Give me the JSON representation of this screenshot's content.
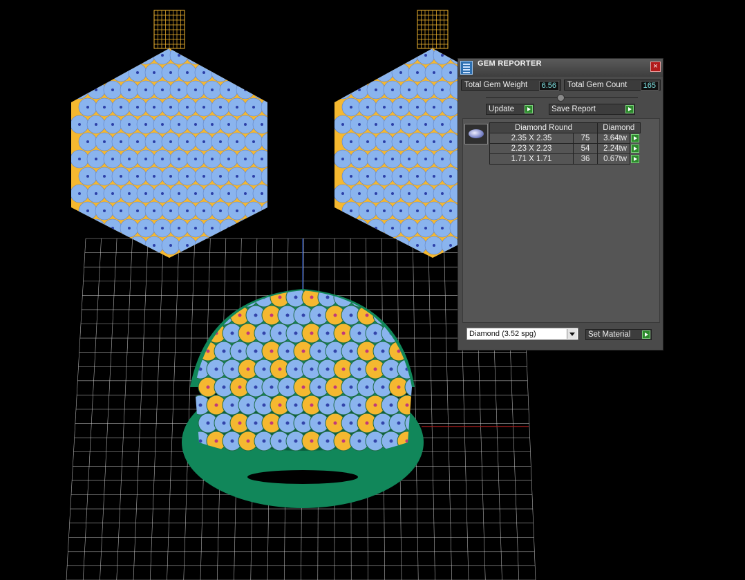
{
  "viewport": {
    "colors": {
      "metal": "#f5b830",
      "gem": "#8ab4ee",
      "shank": "#11875a",
      "grid": "#cfcfcf"
    }
  },
  "gem_reporter": {
    "title": "GEM REPORTER",
    "close_label": "×",
    "total_weight_label": "Total Gem Weight",
    "total_weight_value": "6.56",
    "total_count_label": "Total Gem Count",
    "total_count_value": "165",
    "update_label": "Update",
    "save_report_label": "Save Report",
    "table": {
      "header_shape": "Diamond Round",
      "header_material": "Diamond",
      "rows": [
        {
          "size": "2.35 X 2.35",
          "count": "75",
          "weight": "3.64tw"
        },
        {
          "size": "2.23 X 2.23",
          "count": "54",
          "weight": "2.24tw"
        },
        {
          "size": "1.71 X 1.71",
          "count": "36",
          "weight": "0.67tw"
        }
      ]
    },
    "material_select_value": "Diamond    (3.52 spg)",
    "set_material_label": "Set Material"
  }
}
